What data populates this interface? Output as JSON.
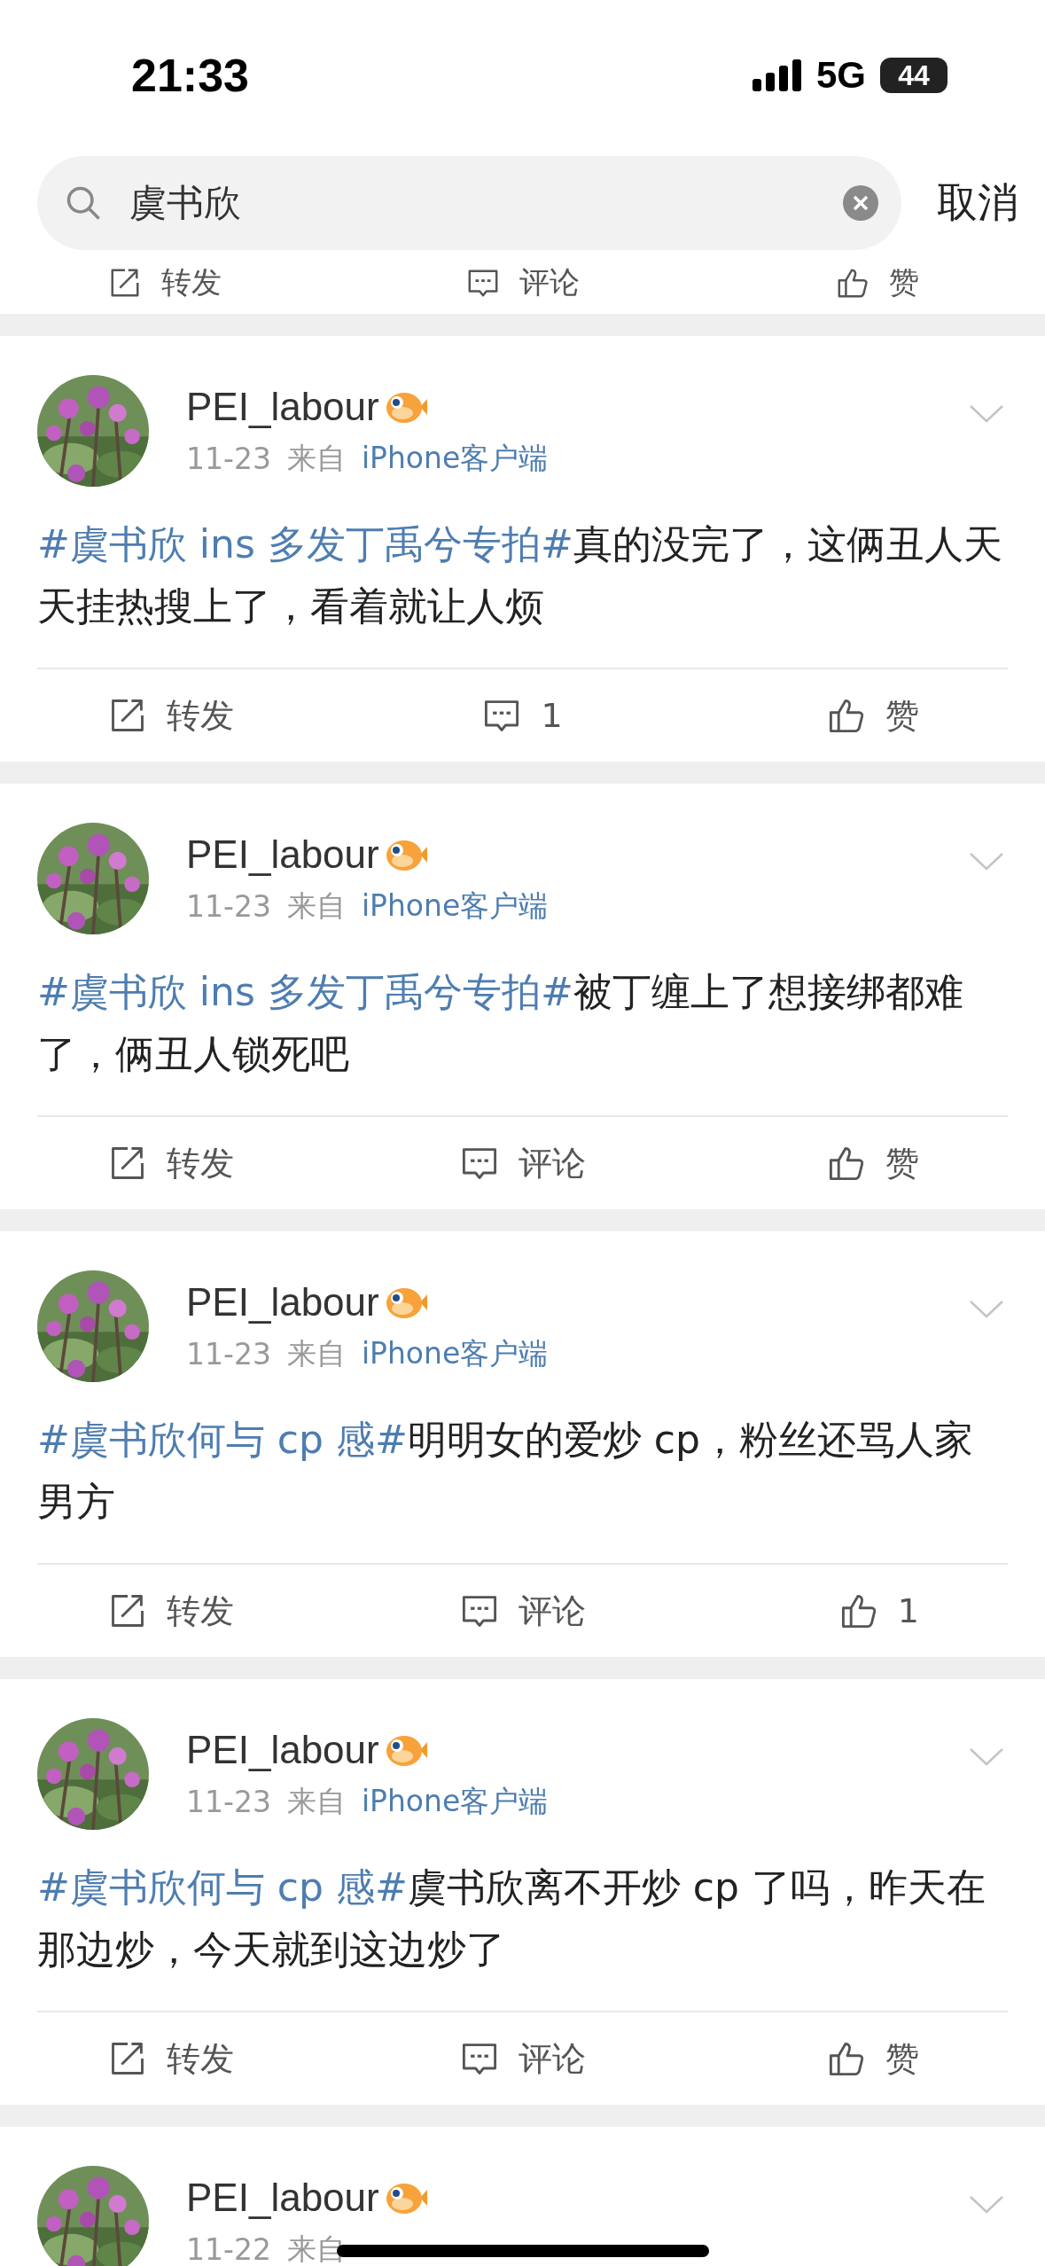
{
  "status_bar": {
    "time": "21:33",
    "network": "5G",
    "battery": "44"
  },
  "search": {
    "value": "虞书欣",
    "cancel": "取消"
  },
  "top_actions": [
    {
      "kind": "repost",
      "label": "转发"
    },
    {
      "kind": "comment",
      "label": "评论"
    },
    {
      "kind": "like",
      "label": "赞"
    }
  ],
  "posts": [
    {
      "author": "PEI_labour",
      "date": "11-23",
      "source_prefix": "来自",
      "source": "iPhone客户端",
      "topic": "#虞书欣 ins 多发丁禹兮专拍#",
      "text": "真的没完了，这俩丑人天天挂热搜上了，看着就让人烦",
      "actions": [
        {
          "kind": "repost",
          "label": "转发"
        },
        {
          "kind": "comment",
          "label": "1"
        },
        {
          "kind": "like",
          "label": "赞"
        }
      ]
    },
    {
      "author": "PEI_labour",
      "date": "11-23",
      "source_prefix": "来自",
      "source": "iPhone客户端",
      "topic": "#虞书欣 ins 多发丁禹兮专拍#",
      "text": "被丁缠上了想接绑都难了，俩丑人锁死吧",
      "actions": [
        {
          "kind": "repost",
          "label": "转发"
        },
        {
          "kind": "comment",
          "label": "评论"
        },
        {
          "kind": "like",
          "label": "赞"
        }
      ]
    },
    {
      "author": "PEI_labour",
      "date": "11-23",
      "source_prefix": "来自",
      "source": "iPhone客户端",
      "topic": "#虞书欣何与 cp 感#",
      "text": "明明女的爱炒 cp，粉丝还骂人家男方",
      "actions": [
        {
          "kind": "repost",
          "label": "转发"
        },
        {
          "kind": "comment",
          "label": "评论"
        },
        {
          "kind": "like",
          "label": "1"
        }
      ]
    },
    {
      "author": "PEI_labour",
      "date": "11-23",
      "source_prefix": "来自",
      "source": "iPhone客户端",
      "topic": "#虞书欣何与 cp 感#",
      "text": "虞书欣离不开炒 cp 了吗，昨天在那边炒，今天就到这边炒了",
      "actions": [
        {
          "kind": "repost",
          "label": "转发"
        },
        {
          "kind": "comment",
          "label": "评论"
        },
        {
          "kind": "like",
          "label": "赞"
        }
      ]
    },
    {
      "author": "PEI_labour",
      "date": "11-22",
      "source_prefix": "来自"
    }
  ]
}
